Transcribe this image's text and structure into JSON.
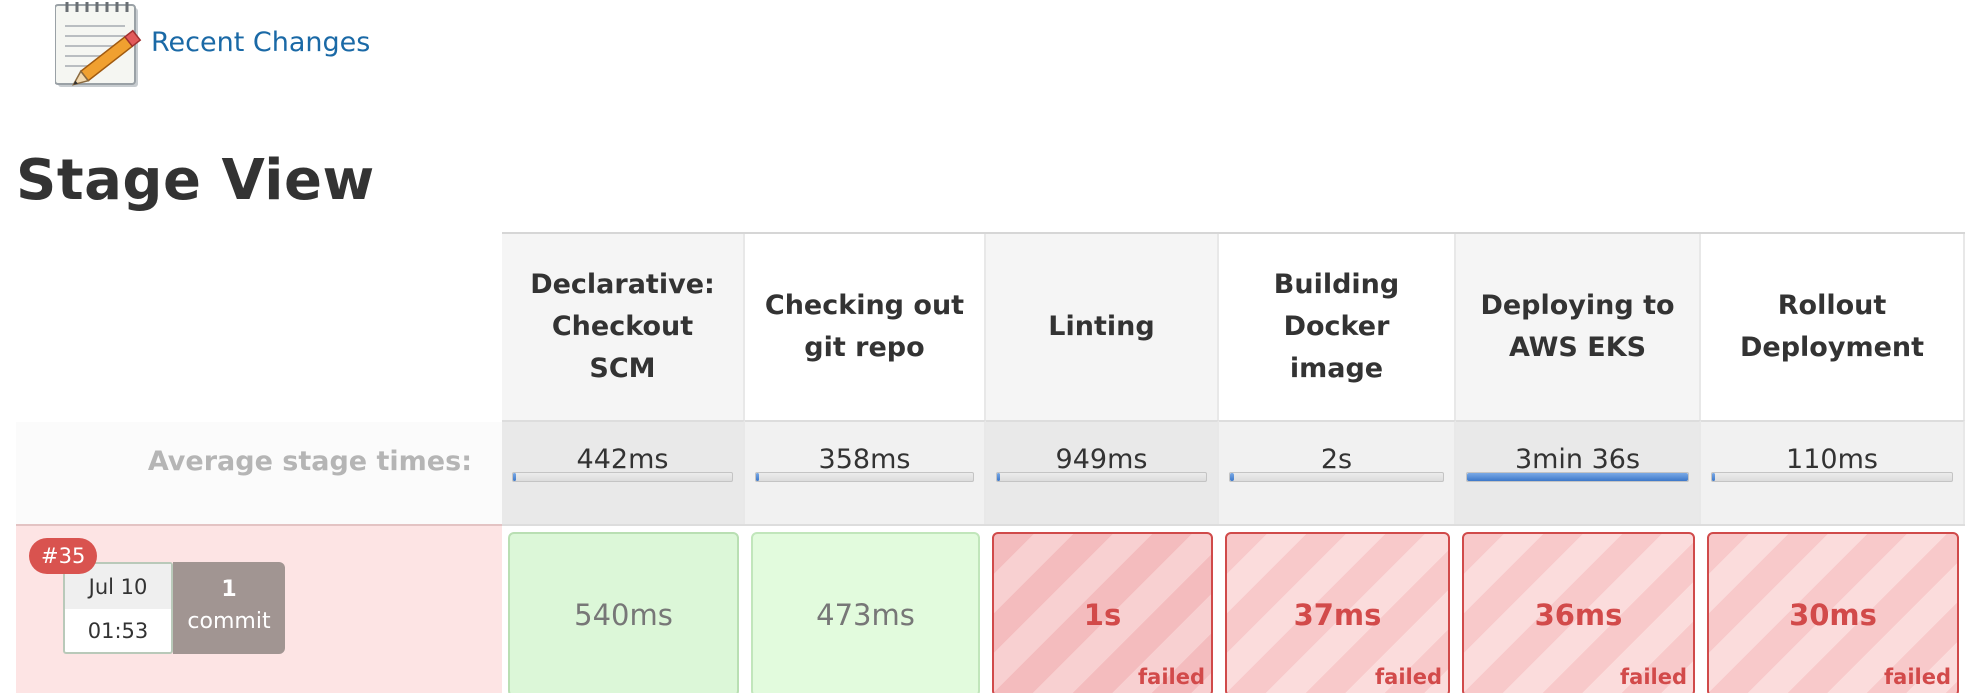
{
  "recent_changes": {
    "label": "Recent Changes",
    "icon": "notepad-pencil-icon"
  },
  "page_title": "Stage View",
  "avg_label": "Average stage times:",
  "stages": [
    {
      "name_lines": [
        "Declarative:",
        "Checkout",
        "SCM"
      ],
      "avg": "442ms",
      "avg_fraction": 0.01,
      "run": "540ms",
      "status": "success"
    },
    {
      "name_lines": [
        "Checking out",
        "git repo"
      ],
      "avg": "358ms",
      "avg_fraction": 0.01,
      "run": "473ms",
      "status": "success"
    },
    {
      "name_lines": [
        "Linting"
      ],
      "avg": "949ms",
      "avg_fraction": 0.01,
      "run": "1s",
      "status": "failed"
    },
    {
      "name_lines": [
        "Building",
        "Docker",
        "image"
      ],
      "avg": "2s",
      "avg_fraction": 0.02,
      "run": "37ms",
      "status": "failed"
    },
    {
      "name_lines": [
        "Deploying to",
        "AWS EKS"
      ],
      "avg": "3min 36s",
      "avg_fraction": 1.0,
      "run": "36ms",
      "status": "failed"
    },
    {
      "name_lines": [
        "Rollout",
        "Deployment"
      ],
      "avg": "110ms",
      "avg_fraction": 0.005,
      "run": "30ms",
      "status": "failed"
    }
  ],
  "run": {
    "badge": "#35",
    "date": "Jul 10",
    "time": "01:53",
    "commit_count": "1",
    "commit_label": "commit"
  },
  "failed_label": "failed",
  "colors": {
    "link": "#1a69a6",
    "fail": "#d24a4a",
    "progress": "#3d78c9",
    "badge": "#d9534f"
  }
}
